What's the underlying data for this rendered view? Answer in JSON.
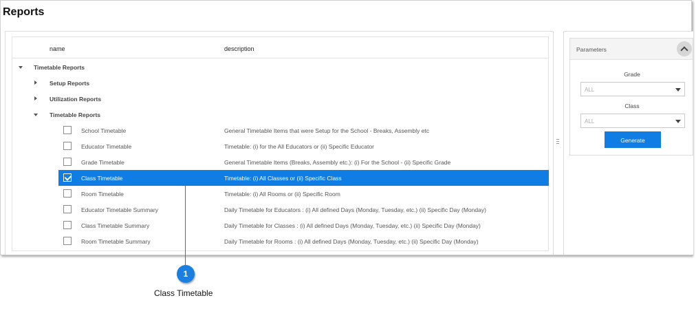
{
  "page": {
    "title": "Reports"
  },
  "grid": {
    "columns": {
      "name": "name",
      "description": "description"
    },
    "groups": [
      {
        "label": "Timetable Reports",
        "expanded": true,
        "level": 0
      },
      {
        "label": "Setup Reports",
        "expanded": false,
        "level": 1
      },
      {
        "label": "Utilization Reports",
        "expanded": false,
        "level": 1
      },
      {
        "label": "Timetable Reports",
        "expanded": true,
        "level": 1
      }
    ],
    "items": [
      {
        "name": "School Timetable",
        "description": "General Timetable Items that were Setup for the School - Breaks, Assembly etc",
        "checked": false
      },
      {
        "name": "Educator Timetable",
        "description": "Timetable: (i) for the All Educators or (ii) Specific Educator",
        "checked": false
      },
      {
        "name": "Grade Timetable",
        "description": "General Timetable Items (Breaks, Assembly etc.): (i) For the School - (ii) Specific Grade",
        "checked": false
      },
      {
        "name": "Class Timetable",
        "description": "Timetable: (i) All Classes or (ii) Specific Class",
        "checked": true
      },
      {
        "name": "Room Timetable",
        "description": "Timetable: (i) All Rooms or (ii) Specific Room",
        "checked": false
      },
      {
        "name": "Educator Timetable Summary",
        "description": "Daily Timetable for Educators : (i) All defined Days (Monday, Tuesday, etc.) (ii) Specific Day (Monday)",
        "checked": false
      },
      {
        "name": "Class Timetable Summary",
        "description": "Daily Timetable for Classes : (i) All defined Days (Monday, Tuesday, etc.) (ii) Specific Day (Monday)",
        "checked": false
      },
      {
        "name": "Room Timetable Summary",
        "description": "Daily Timetable for Rooms : (i) All defined Days (Monday, Tuesday, etc.) (ii) Specific Day (Monday)",
        "checked": false
      }
    ]
  },
  "parameters": {
    "title": "Parameters",
    "grade_label": "Grade",
    "grade_value": "ALL",
    "class_label": "Class",
    "class_value": "ALL",
    "generate_label": "Generate"
  },
  "callout": {
    "number": "1",
    "caption": "Class Timetable"
  },
  "colors": {
    "accent": "#0f7de3"
  }
}
